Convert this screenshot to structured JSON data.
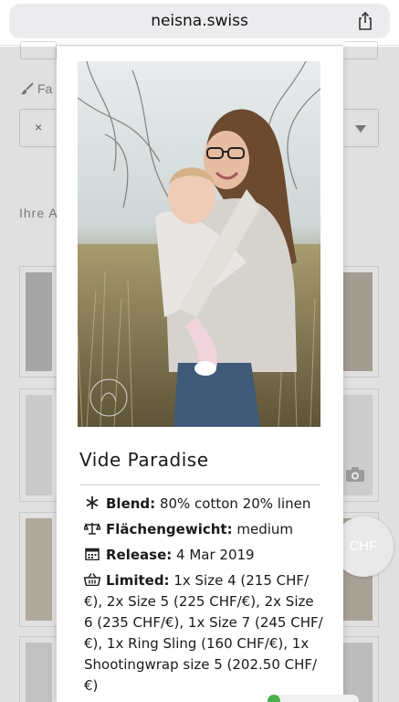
{
  "browser": {
    "url": "neisna.swiss"
  },
  "background": {
    "filter_label_partial": "Fa",
    "section_label_partial": "Ihre A",
    "clear_symbol": "×",
    "chf_button": "CHF"
  },
  "modal": {
    "title": "Vide Paradise",
    "photo_icon": "photo-mother-and-baby-in-wrap",
    "watermark_icon": "photographer-watermark",
    "specs": [
      {
        "icon": "snowflake-icon",
        "label": "Blend:",
        "value": "80% cotton 20% linen"
      },
      {
        "icon": "scale-icon",
        "label": "Flächengewicht:",
        "value": "medium"
      },
      {
        "icon": "calendar-icon",
        "label": "Release:",
        "value": "4 Mar 2019"
      },
      {
        "icon": "basket-icon",
        "label": "Limited:",
        "value": "1x Size 4 (215 CHF/€), 2x Size 5 (225 CHF/€), 2x Size 6 (235 CHF/€), 1x Size 7 (245 CHF/€), 1x Ring Sling (160 CHF/€), 1x Shootingwrap size 5 (202.50 CHF/€)"
      }
    ]
  },
  "colors": {
    "accent_green": "#4caf50"
  }
}
